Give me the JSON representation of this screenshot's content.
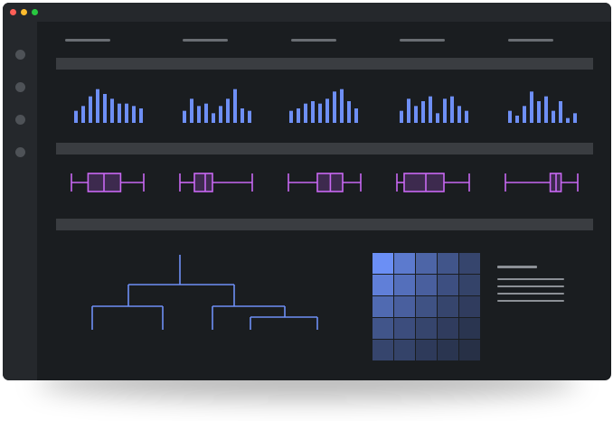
{
  "window": {
    "title_bar_color": "#25282c",
    "background": "#1a1d20",
    "traffic_lights": [
      "#ff5f57",
      "#febc2e",
      "#28c840"
    ]
  },
  "sidebar": {
    "background": "#25282c",
    "items": [
      {
        "icon": "nav-dot-icon"
      },
      {
        "icon": "nav-dot-icon"
      },
      {
        "icon": "nav-dot-icon"
      },
      {
        "icon": "nav-dot-icon"
      }
    ],
    "item_color": "#4e5257"
  },
  "tabs": {
    "count": 5,
    "color": "#6a6e73"
  },
  "section_band_color": "#3a3d41",
  "chart_data": [
    {
      "type": "bar",
      "color": "#6e8ff5",
      "series": [
        {
          "values": [
            5,
            7,
            11,
            14,
            12,
            10,
            8,
            8,
            7,
            6
          ]
        },
        {
          "values": [
            5,
            10,
            7,
            8,
            4,
            7,
            10,
            14,
            6,
            5
          ]
        },
        {
          "values": [
            5,
            6,
            8,
            9,
            8,
            10,
            13,
            14,
            9,
            6
          ]
        },
        {
          "values": [
            5,
            10,
            7,
            9,
            11,
            4,
            10,
            11,
            7,
            5
          ]
        },
        {
          "values": [
            5,
            3,
            7,
            13,
            9,
            11,
            5,
            9,
            2,
            4
          ]
        }
      ],
      "ylim": [
        0,
        15
      ]
    },
    {
      "type": "boxplot",
      "color": "#c868f2",
      "fill": "#3d2a4e",
      "series": [
        {
          "min": 0,
          "q1": 0.23,
          "median": 0.45,
          "q3": 0.68,
          "max": 1
        },
        {
          "min": 0,
          "q1": 0.2,
          "median": 0.35,
          "q3": 0.45,
          "max": 1
        },
        {
          "min": 0,
          "q1": 0.4,
          "median": 0.58,
          "q3": 0.75,
          "max": 1
        },
        {
          "min": 0,
          "q1": 0.1,
          "median": 0.4,
          "q3": 0.65,
          "max": 1
        },
        {
          "min": 0,
          "q1": 0.62,
          "median": 0.7,
          "q3": 0.77,
          "max": 1
        }
      ]
    },
    {
      "type": "dendrogram",
      "color": "#6e8ff5",
      "leaves": 5
    },
    {
      "type": "heatmap",
      "rows": 5,
      "cols": 5,
      "values": [
        [
          1.0,
          0.8,
          0.6,
          0.45,
          0.3
        ],
        [
          0.85,
          0.7,
          0.55,
          0.4,
          0.28
        ],
        [
          0.65,
          0.55,
          0.42,
          0.3,
          0.22
        ],
        [
          0.45,
          0.38,
          0.3,
          0.22,
          0.15
        ],
        [
          0.3,
          0.28,
          0.2,
          0.15,
          0.1
        ]
      ],
      "low_color": "#1f2533",
      "high_color": "#6b8ff5"
    }
  ],
  "legend": {
    "line_color": "#8c9096",
    "lines": 5
  }
}
